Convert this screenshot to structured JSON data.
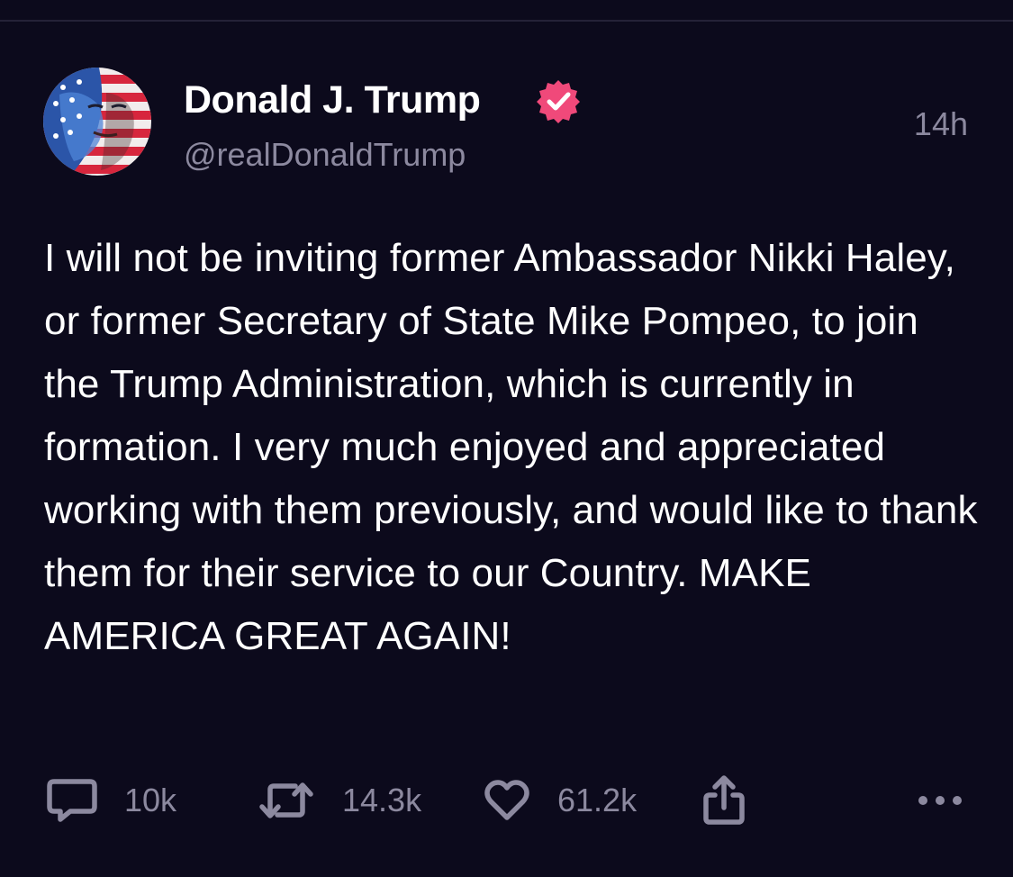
{
  "post": {
    "display_name": "Donald J. Trump",
    "handle": "@realDonaldTrump",
    "timestamp": "14h",
    "body": "I will not be inviting former Ambassador Nikki Haley, or former Secretary of State Mike Pompeo, to join the Trump Administration, which is currently in formation. I very much enjoyed and appreciated working with them previously, and would like to thank them for their service to our Country. MAKE AMERICA GREAT AGAIN!",
    "verified_icon": "verified-badge-icon",
    "verified_color": "#f0497a"
  },
  "actions": {
    "reply": {
      "icon": "reply-bubble-icon",
      "count": "10k"
    },
    "repost": {
      "icon": "repost-icon",
      "count": "14.3k"
    },
    "like": {
      "icon": "heart-icon",
      "count": "61.2k"
    },
    "share": {
      "icon": "share-icon"
    },
    "more": {
      "icon": "more-dots-icon"
    }
  },
  "colors": {
    "background": "#0c0a1c",
    "text": "#ffffff",
    "muted": "#8c899f"
  }
}
